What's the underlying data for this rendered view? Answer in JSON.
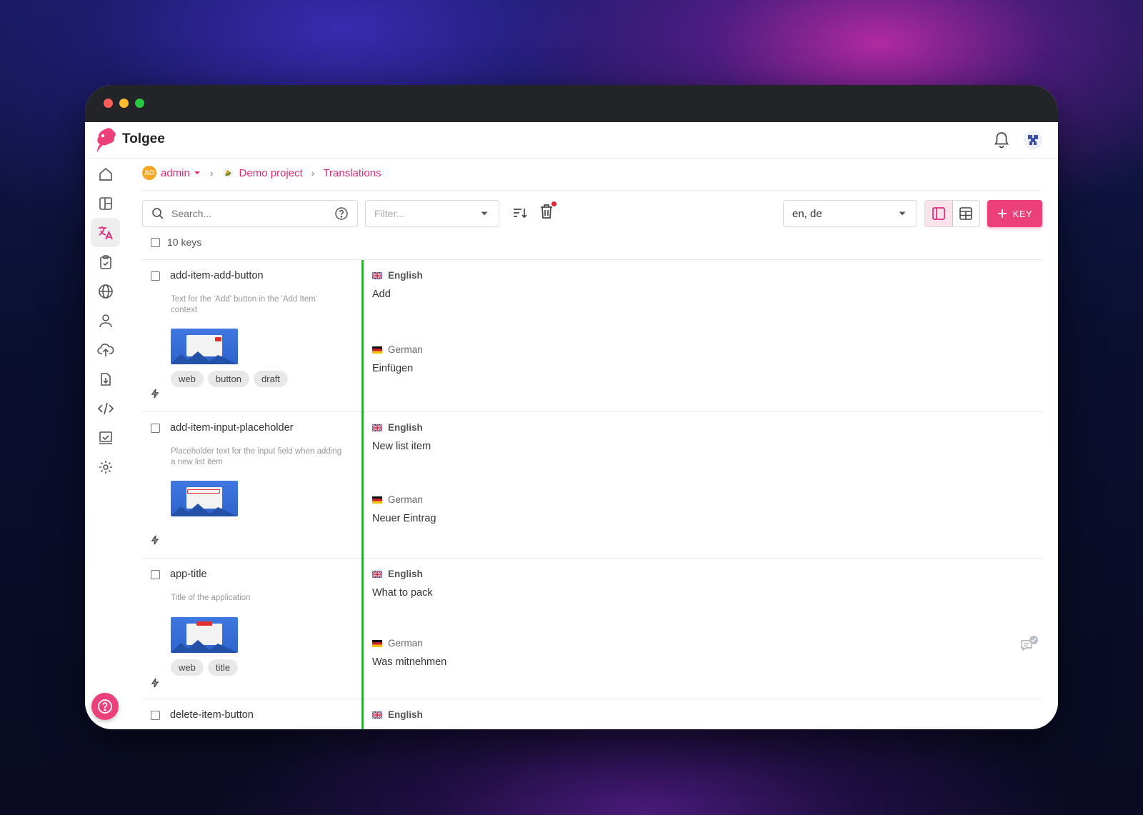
{
  "app": {
    "name": "Tolgee"
  },
  "breadcrumb": {
    "avatar_initials": "AD",
    "org": "admin",
    "project": "Demo project",
    "page": "Translations"
  },
  "toolbar": {
    "search_placeholder": "Search...",
    "filter_placeholder": "Filter...",
    "languages": "en, de",
    "add_key_label": "KEY"
  },
  "keys_count": "10 keys",
  "rows": [
    {
      "key": "add-item-add-button",
      "description": "Text for the 'Add' button in the 'Add Item' context",
      "tags": [
        "web",
        "button",
        "draft"
      ],
      "translations": [
        {
          "lang": "English",
          "text": "Add"
        },
        {
          "lang": "German",
          "text": "Einfügen"
        }
      ]
    },
    {
      "key": "add-item-input-placeholder",
      "description": "Placeholder text for the input field when adding a new list item",
      "tags": [],
      "translations": [
        {
          "lang": "English",
          "text": "New list item"
        },
        {
          "lang": "German",
          "text": "Neuer Eintrag"
        }
      ]
    },
    {
      "key": "app-title",
      "description": "Title of the application",
      "tags": [
        "web",
        "title"
      ],
      "translations": [
        {
          "lang": "English",
          "text": "What to pack"
        },
        {
          "lang": "German",
          "text": "Was mitnehmen"
        }
      ]
    },
    {
      "key": "delete-item-button",
      "translations": [
        {
          "lang": "English"
        }
      ]
    }
  ],
  "colors": {
    "accent": "#ec407a",
    "breadcrumb_link": "#e0287a",
    "state_bar": "#2db33b",
    "window_titlebar": "#232427"
  },
  "icons": {
    "sidebar": [
      "home-icon",
      "dashboard-icon",
      "translate-icon",
      "tasks-icon",
      "languages-globe-icon",
      "members-icon",
      "import-icon",
      "export-icon",
      "integrate-code-icon",
      "review-icon",
      "settings-icon"
    ],
    "topbar": [
      "bell-icon",
      "user-avatar-icon"
    ]
  }
}
